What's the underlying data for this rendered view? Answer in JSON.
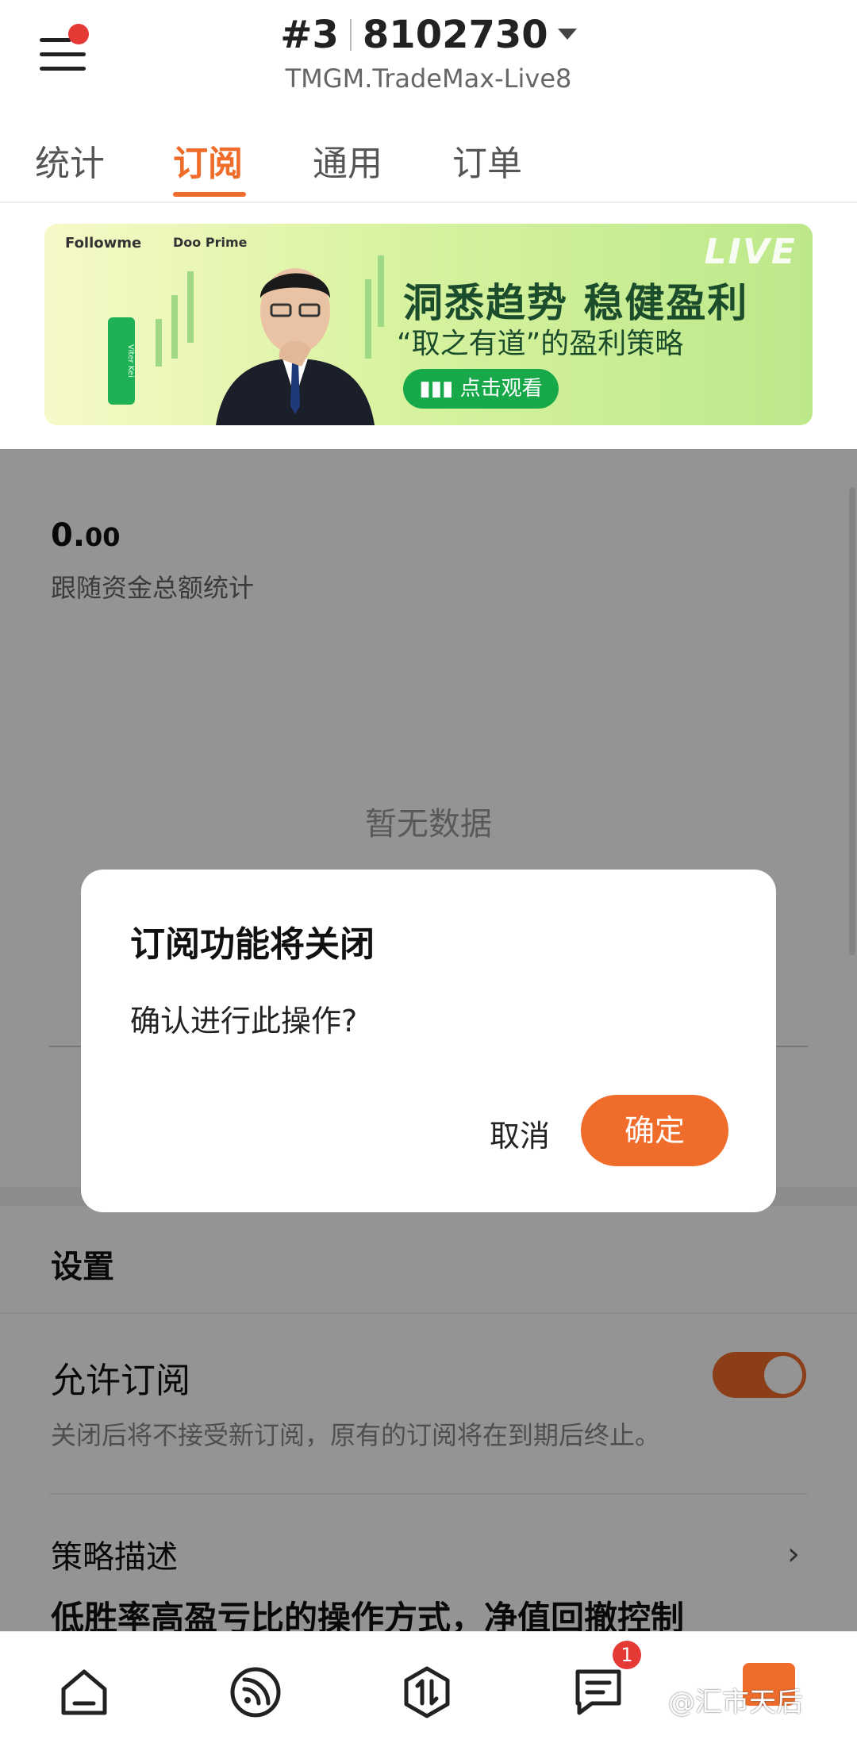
{
  "header": {
    "account_number": "#3",
    "account_id": "8102730",
    "server": "TMGM.TradeMax-Live8"
  },
  "tabs": [
    {
      "label": "统计",
      "active": false
    },
    {
      "label": "订阅",
      "active": true
    },
    {
      "label": "通用",
      "active": false
    },
    {
      "label": "订单",
      "active": false
    }
  ],
  "banner": {
    "brand_followme": "Followme",
    "brand_partner": "Doo Prime",
    "live": "LIVE",
    "headline": "洞悉趋势 稳健盈利",
    "subheadline": "“取之有道”的盈利策略",
    "watch_button": "点击观看",
    "vertical_tag": "Viter Kei"
  },
  "stats": {
    "total_int": "0.",
    "total_dec": "00",
    "total_label": "跟随资金总额统计",
    "empty_text": "暂无数据"
  },
  "settings": {
    "title": "设置",
    "allow_label": "允许订阅",
    "allow_desc": "关闭后将不接受新订阅，原有的订阅将在到期后终止。",
    "allow_enabled": true,
    "strategy_label": "策略描述",
    "strategy_text": "低胜率高盈亏比的操作方式，净值回撤控制"
  },
  "dialog": {
    "title": "订阅功能将关闭",
    "message": "确认进行此操作?",
    "cancel_label": "取消",
    "confirm_label": "确定"
  },
  "bottom_nav": {
    "icons": [
      "home-icon",
      "feed-icon",
      "trade-icon",
      "messages-icon",
      "profile-icon"
    ],
    "messages_badge": "1",
    "watermark": "@汇市天后"
  },
  "colors": {
    "accent": "#ef6c2a",
    "badge": "#e53935"
  }
}
